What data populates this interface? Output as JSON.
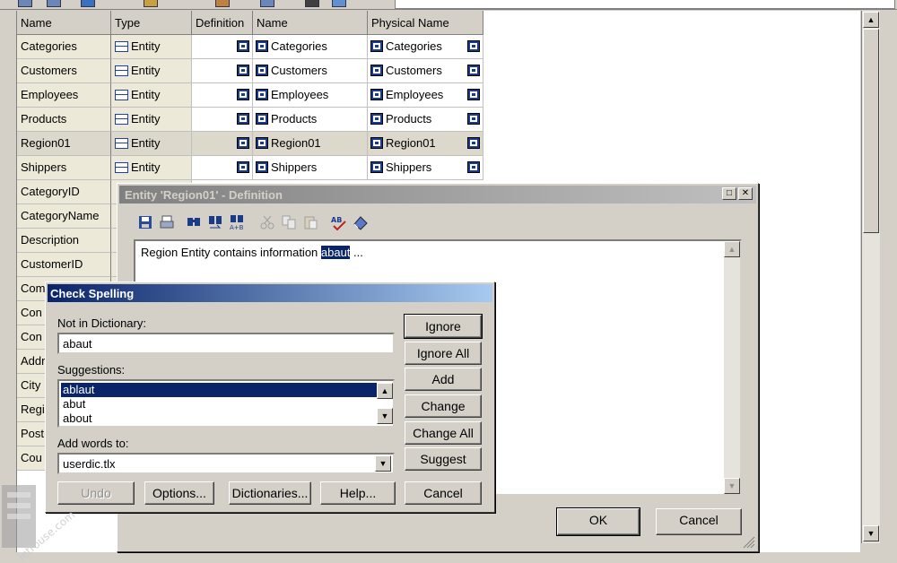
{
  "grid": {
    "headers": [
      "Name",
      "Type",
      "Definition",
      "Name",
      "Physical Name"
    ],
    "entity_type": "Entity",
    "entity_rows": [
      {
        "name": "Categories",
        "type": "Entity",
        "logical": "Categories",
        "physical": "Categories"
      },
      {
        "name": "Customers",
        "type": "Entity",
        "logical": "Customers",
        "physical": "Customers"
      },
      {
        "name": "Employees",
        "type": "Entity",
        "logical": "Employees",
        "physical": "Employees"
      },
      {
        "name": "Products",
        "type": "Entity",
        "logical": "Products",
        "physical": "Products"
      },
      {
        "name": "Region01",
        "type": "Entity",
        "logical": "Region01",
        "physical": "Region01"
      },
      {
        "name": "Shippers",
        "type": "Entity",
        "logical": "Shippers",
        "physical": "Shippers"
      }
    ],
    "attribute_rows": [
      "CategoryID",
      "CategoryName",
      "Description",
      "CustomerID",
      "Com",
      "Con",
      "Con",
      "Addr",
      "City",
      "Regi",
      "Post",
      "Cou"
    ],
    "selected_row": "Region01"
  },
  "definition_window": {
    "title": "Entity 'Region01' - Definition",
    "text_before": "Region Entity contains information ",
    "highlight": "abaut",
    "text_after": " ...",
    "ok_label": "OK",
    "cancel_label": "Cancel",
    "toolbar_icons": [
      "save-icon",
      "print-icon",
      "find-icon",
      "find-next-icon",
      "replace-icon",
      "cut-icon",
      "copy-icon",
      "paste-icon",
      "spellcheck-icon",
      "eraser-icon"
    ]
  },
  "spell_dialog": {
    "title": "Check Spelling",
    "not_in_dictionary_label": "Not in Dictionary:",
    "not_in_dictionary_value": "abaut",
    "suggestions_label": "Suggestions:",
    "suggestions": [
      "ablaut",
      "abut",
      "about"
    ],
    "selected_suggestion": "ablaut",
    "add_words_label": "Add words to:",
    "add_words_value": "userdic.tlx",
    "buttons": {
      "ignore": "Ignore",
      "ignore_all": "Ignore All",
      "add": "Add",
      "change": "Change",
      "change_all": "Change All",
      "suggest": "Suggest",
      "undo": "Undo",
      "options": "Options...",
      "dictionaries": "Dictionaries...",
      "help": "Help...",
      "cancel": "Cancel"
    }
  },
  "watermark": "jetrouse.com"
}
